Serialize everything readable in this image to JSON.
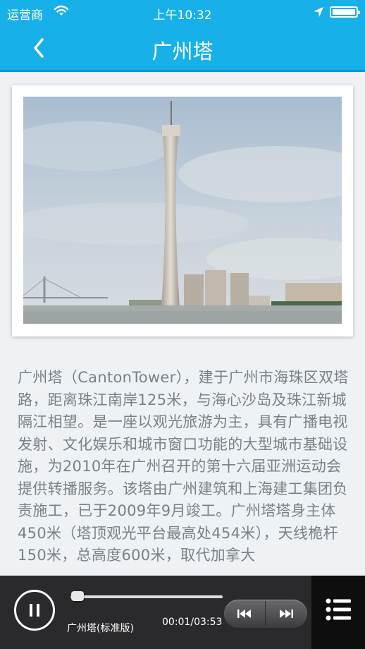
{
  "status_bar": {
    "carrier": "运营商",
    "time": "上午10:32"
  },
  "nav": {
    "title": "广州塔"
  },
  "description": "广州塔（CantonTower），建于广州市海珠区双塔路，距离珠江南岸125米，与海心沙岛及珠江新城隔江相望。是一座以观光旅游为主，具有广播电视发射、文化娱乐和城市窗口功能的大型城市基础设施，为2010年在广州召开的第十六届亚洲运动会提供转播服务。该塔由广州建筑和上海建工集团负责施工，已于2009年9月竣工。广州塔塔身主体450米（塔顶观光平台最高处454米），天线桅杆150米，总高度600米，取代加拿大",
  "player": {
    "track_name": "广州塔(标准版)",
    "time": "00:01/03:53",
    "progress": 0.005
  },
  "colors": {
    "accent": "#18b0e8",
    "text": "#7b8088",
    "player_bg": "#2a2a2c"
  },
  "icons": {
    "back": "chevron-left-icon",
    "pause": "pause-icon",
    "prev": "skip-back-icon",
    "next": "skip-forward-icon",
    "playlist": "list-icon"
  }
}
